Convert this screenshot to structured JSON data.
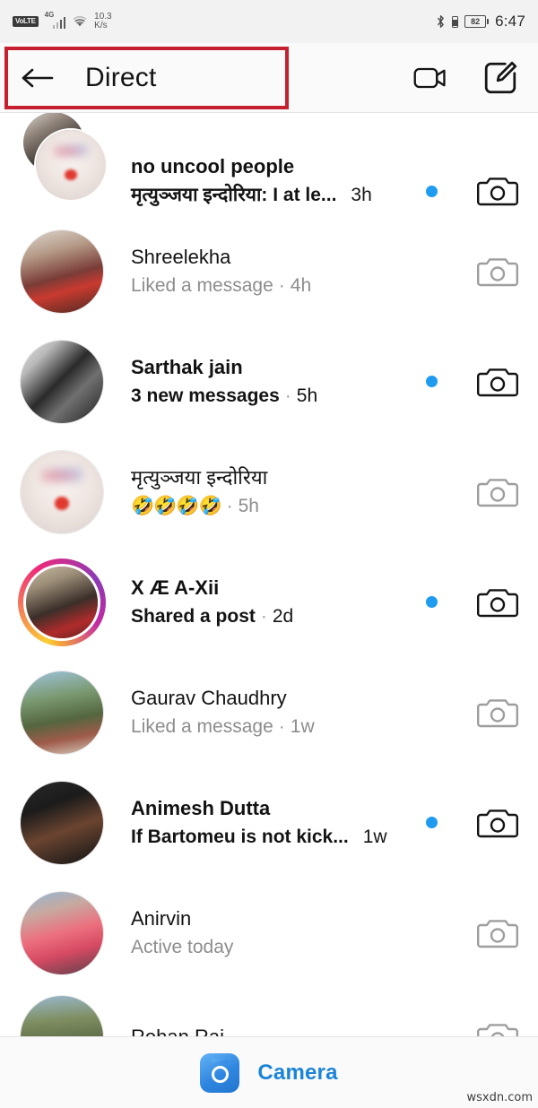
{
  "statusbar": {
    "volte": "VoLTE",
    "network_type": "4G",
    "net_speed_value": "10.3",
    "net_speed_unit": "K/s",
    "battery_percent": "82",
    "time": "6:47",
    "icons": [
      "volte-badge",
      "signal-bars-icon",
      "wifi-icon",
      "bluetooth-icon",
      "vibrate-icon",
      "battery-icon"
    ]
  },
  "header": {
    "back_icon": "back-arrow-icon",
    "title": "Direct",
    "video_call_icon": "video-camera-icon",
    "compose_icon": "compose-pencil-icon"
  },
  "annotation": {
    "color": "#c62030",
    "target": "back-arrow-and-direct-title"
  },
  "colors": {
    "unread_dot": "#1f9bf0",
    "camera_blue": "#1b84d8",
    "story_ring_start": "#f9ce34",
    "story_ring_mid": "#ee2a7b",
    "story_ring_end": "#8b3ab5",
    "text_primary": "#121212",
    "text_muted": "#8d8d8d"
  },
  "conversations": [
    {
      "name": "no uncool people",
      "preview": "मृत्युञ्जया इन्दोरिया: I at le...",
      "time": "3h",
      "unread": true,
      "separator": false,
      "avatar_type": "group",
      "has_story_ring": false,
      "camera_icon": "camera-icon",
      "unread_dot": "unread-dot"
    },
    {
      "name": "Shreelekha",
      "preview": "Liked a message",
      "time": "4h",
      "unread": false,
      "separator": true,
      "avatar_type": "single",
      "has_story_ring": false,
      "camera_icon": "camera-icon",
      "unread_dot": ""
    },
    {
      "name": "Sarthak jain",
      "preview": "3 new messages",
      "time": "5h",
      "unread": true,
      "separator": true,
      "avatar_type": "single",
      "has_story_ring": false,
      "camera_icon": "camera-icon",
      "unread_dot": "unread-dot"
    },
    {
      "name": "मृत्युञ्जया इन्दोरिया",
      "preview": "🤣🤣🤣🤣",
      "time": "5h",
      "unread": false,
      "separator": true,
      "avatar_type": "single",
      "has_story_ring": false,
      "camera_icon": "camera-icon",
      "unread_dot": ""
    },
    {
      "name": "X Æ A-Xii",
      "preview": "Shared a post",
      "time": "2d",
      "unread": true,
      "separator": true,
      "avatar_type": "single",
      "has_story_ring": true,
      "camera_icon": "camera-icon",
      "unread_dot": "unread-dot"
    },
    {
      "name": "Gaurav Chaudhry",
      "preview": "Liked a message",
      "time": "1w",
      "unread": false,
      "separator": true,
      "avatar_type": "single",
      "has_story_ring": false,
      "camera_icon": "camera-icon",
      "unread_dot": ""
    },
    {
      "name": "Animesh Dutta",
      "preview": "If Bartomeu is not kick...",
      "time": "1w",
      "unread": true,
      "separator": false,
      "avatar_type": "single",
      "has_story_ring": false,
      "camera_icon": "camera-icon",
      "unread_dot": "unread-dot"
    },
    {
      "name": "Anirvin",
      "preview": "Active today",
      "time": "",
      "unread": false,
      "separator": false,
      "avatar_type": "single",
      "has_story_ring": false,
      "camera_icon": "camera-icon",
      "unread_dot": ""
    },
    {
      "name": "Rohan Raj",
      "preview": "",
      "time": "",
      "unread": false,
      "separator": false,
      "avatar_type": "single",
      "has_story_ring": false,
      "camera_icon": "camera-icon",
      "unread_dot": ""
    }
  ],
  "bottombar": {
    "camera_icon": "camera-tile-icon",
    "camera_label": "Camera"
  },
  "watermark": "wsxdn.com"
}
